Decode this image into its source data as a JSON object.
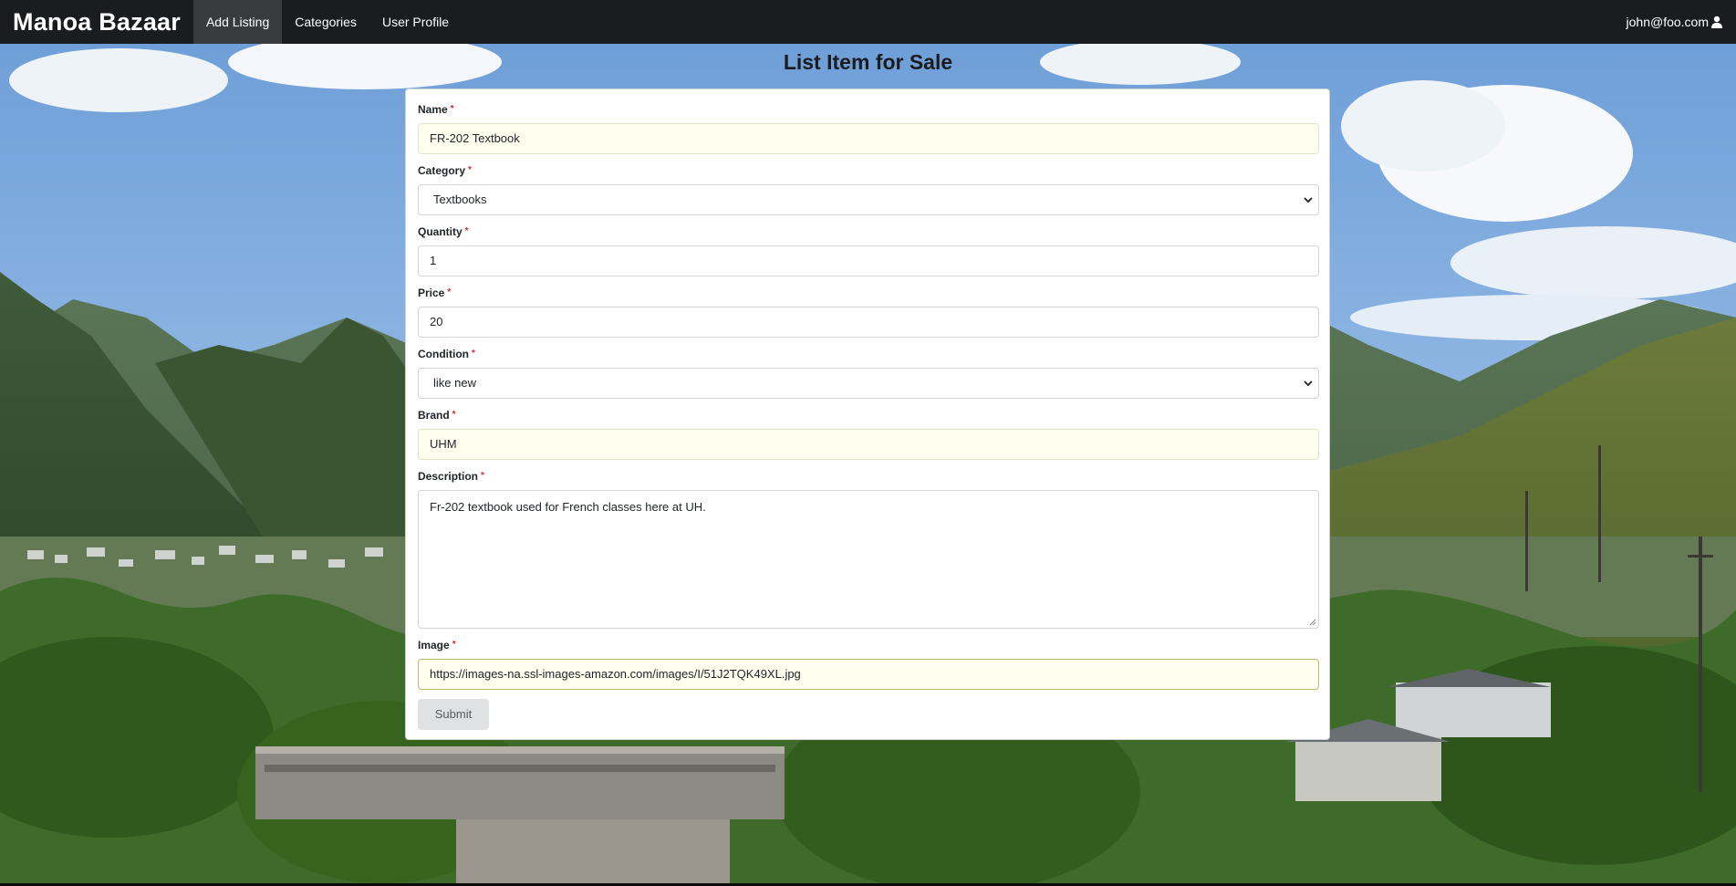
{
  "navbar": {
    "brand": "Manoa Bazaar",
    "items": [
      {
        "label": "Add Listing",
        "active": true
      },
      {
        "label": "Categories",
        "active": false
      },
      {
        "label": "User Profile",
        "active": false
      }
    ],
    "user_email": "john@foo.com",
    "user_icon": "user-icon"
  },
  "page": {
    "title": "List Item for Sale"
  },
  "form": {
    "required_marker": "*",
    "name": {
      "label": "Name",
      "value": "FR-202 Textbook"
    },
    "category": {
      "label": "Category",
      "value": "Textbooks"
    },
    "quantity": {
      "label": "Quantity",
      "value": "1"
    },
    "price": {
      "label": "Price",
      "value": "20"
    },
    "condition": {
      "label": "Condition",
      "value": "like new"
    },
    "brand": {
      "label": "Brand",
      "value": "UHM"
    },
    "description": {
      "label": "Description",
      "value": "Fr-202 textbook used for French classes here at UH."
    },
    "image": {
      "label": "Image",
      "value": "https://images-na.ssl-images-amazon.com/images/I/51J2TQK49XL.jpg"
    },
    "submit_label": "Submit"
  },
  "colors": {
    "navbar_bg": "#1b1c1d",
    "required": "#db2828",
    "filled_field_bg": "#fffff0"
  }
}
